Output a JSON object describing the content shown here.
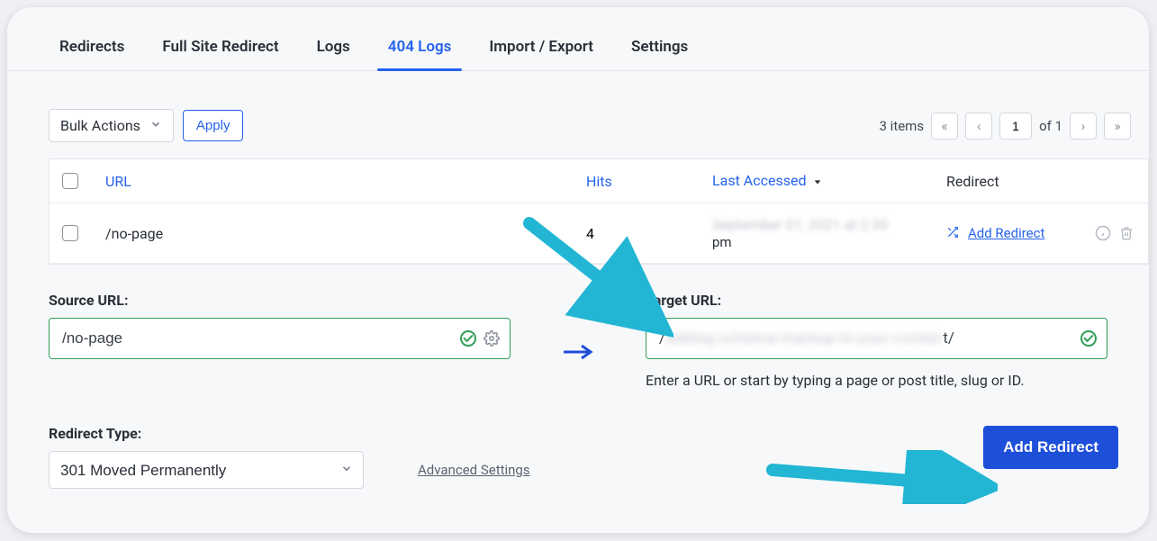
{
  "tabs": {
    "redirects": "Redirects",
    "full_site": "Full Site Redirect",
    "logs": "Logs",
    "logs404": "404 Logs",
    "import_export": "Import / Export",
    "settings": "Settings"
  },
  "toolbar": {
    "bulk_label": "Bulk Actions",
    "apply_label": "Apply"
  },
  "pagination": {
    "items_label": "3 items",
    "current_page": "1",
    "of_label": "of 1"
  },
  "table": {
    "headers": {
      "url": "URL",
      "hits": "Hits",
      "last_accessed": "Last Accessed",
      "redirect": "Redirect"
    },
    "rows": [
      {
        "url": "/no-page",
        "hits": "4",
        "last_accessed_blur": "September 01, 2021 at 2:30",
        "last_accessed_suffix": "pm",
        "redirect_action": "Add Redirect"
      }
    ]
  },
  "form": {
    "source_label": "Source URL:",
    "source_value": "/no-page",
    "target_label": "Target URL:",
    "target_value_prefix": "/",
    "target_value_blur": "adding-schema-markup-in-your-conten",
    "target_value_suffix": "t/",
    "target_helper": "Enter a URL or start by typing a page or post title, slug or ID.",
    "redirect_type_label": "Redirect Type:",
    "redirect_type_value": "301 Moved Permanently",
    "advanced_link": "Advanced Settings",
    "submit_label": "Add Redirect"
  }
}
